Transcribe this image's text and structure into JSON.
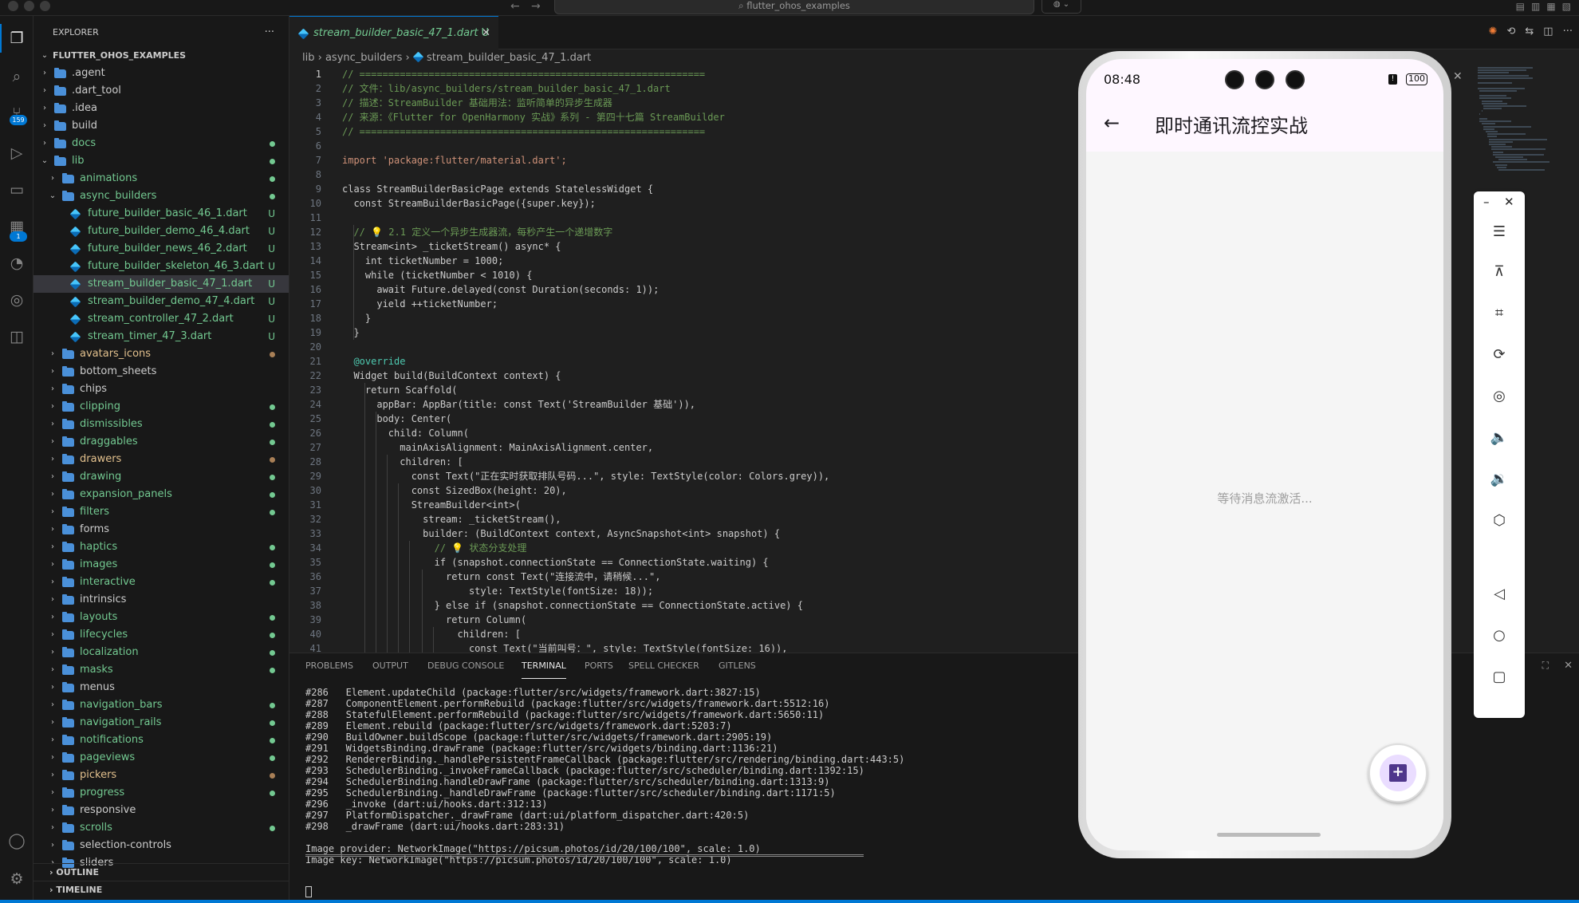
{
  "titlebar": {
    "search_text": "flutter_ohos_examples"
  },
  "activity_badges": {
    "scm": "159",
    "extensions": "1"
  },
  "explorer": {
    "title": "EXPLORER",
    "root": "FLUTTER_OHOS_EXAMPLES",
    "items": [
      {
        "label": ".agent",
        "kind": "folder",
        "depth": 1,
        "open": false,
        "color": "#cccccc",
        "mark": ""
      },
      {
        "label": ".dart_tool",
        "kind": "folder",
        "depth": 1,
        "open": false,
        "color": "#cccccc",
        "mark": ""
      },
      {
        "label": ".idea",
        "kind": "folder",
        "depth": 1,
        "open": false,
        "color": "#cccccc",
        "mark": ""
      },
      {
        "label": "build",
        "kind": "folder",
        "depth": 1,
        "open": false,
        "color": "#cccccc",
        "mark": ""
      },
      {
        "label": "docs",
        "kind": "folder",
        "depth": 1,
        "open": false,
        "color": "#73c991",
        "mark": "dot-green"
      },
      {
        "label": "lib",
        "kind": "folder",
        "depth": 1,
        "open": true,
        "color": "#73c991",
        "mark": "dot-green"
      },
      {
        "label": "animations",
        "kind": "folder",
        "depth": 2,
        "open": false,
        "color": "#73c991",
        "mark": "dot-green"
      },
      {
        "label": "async_builders",
        "kind": "folder",
        "depth": 2,
        "open": true,
        "color": "#73c991",
        "mark": "dot-green"
      },
      {
        "label": "future_builder_basic_46_1.dart",
        "kind": "dart",
        "depth": 3,
        "color": "#73c991",
        "mark": "U"
      },
      {
        "label": "future_builder_demo_46_4.dart",
        "kind": "dart",
        "depth": 3,
        "color": "#73c991",
        "mark": "U"
      },
      {
        "label": "future_builder_news_46_2.dart",
        "kind": "dart",
        "depth": 3,
        "color": "#73c991",
        "mark": "U"
      },
      {
        "label": "future_builder_skeleton_46_3.dart",
        "kind": "dart",
        "depth": 3,
        "color": "#73c991",
        "mark": "U"
      },
      {
        "label": "stream_builder_basic_47_1.dart",
        "kind": "dart",
        "depth": 3,
        "color": "#73c991",
        "mark": "U",
        "selected": true
      },
      {
        "label": "stream_builder_demo_47_4.dart",
        "kind": "dart",
        "depth": 3,
        "color": "#73c991",
        "mark": "U"
      },
      {
        "label": "stream_controller_47_2.dart",
        "kind": "dart",
        "depth": 3,
        "color": "#73c991",
        "mark": "U"
      },
      {
        "label": "stream_timer_47_3.dart",
        "kind": "dart",
        "depth": 3,
        "color": "#73c991",
        "mark": "U"
      },
      {
        "label": "avatars_icons",
        "kind": "folder",
        "depth": 2,
        "open": false,
        "color": "#e2c08d",
        "mark": "dot-brown"
      },
      {
        "label": "bottom_sheets",
        "kind": "folder",
        "depth": 2,
        "open": false,
        "color": "#cccccc",
        "mark": ""
      },
      {
        "label": "chips",
        "kind": "folder",
        "depth": 2,
        "open": false,
        "color": "#cccccc",
        "mark": ""
      },
      {
        "label": "clipping",
        "kind": "folder",
        "depth": 2,
        "open": false,
        "color": "#73c991",
        "mark": "dot-green"
      },
      {
        "label": "dismissibles",
        "kind": "folder",
        "depth": 2,
        "open": false,
        "color": "#73c991",
        "mark": "dot-green"
      },
      {
        "label": "draggables",
        "kind": "folder",
        "depth": 2,
        "open": false,
        "color": "#73c991",
        "mark": "dot-green"
      },
      {
        "label": "drawers",
        "kind": "folder",
        "depth": 2,
        "open": false,
        "color": "#e2c08d",
        "mark": "dot-brown"
      },
      {
        "label": "drawing",
        "kind": "folder",
        "depth": 2,
        "open": false,
        "color": "#73c991",
        "mark": "dot-green"
      },
      {
        "label": "expansion_panels",
        "kind": "folder",
        "depth": 2,
        "open": false,
        "color": "#73c991",
        "mark": "dot-green"
      },
      {
        "label": "filters",
        "kind": "folder",
        "depth": 2,
        "open": false,
        "color": "#73c991",
        "mark": "dot-green"
      },
      {
        "label": "forms",
        "kind": "folder",
        "depth": 2,
        "open": false,
        "color": "#cccccc",
        "mark": ""
      },
      {
        "label": "haptics",
        "kind": "folder",
        "depth": 2,
        "open": false,
        "color": "#73c991",
        "mark": "dot-green"
      },
      {
        "label": "images",
        "kind": "folder",
        "depth": 2,
        "open": false,
        "color": "#73c991",
        "mark": "dot-green"
      },
      {
        "label": "interactive",
        "kind": "folder",
        "depth": 2,
        "open": false,
        "color": "#73c991",
        "mark": "dot-green"
      },
      {
        "label": "intrinsics",
        "kind": "folder",
        "depth": 2,
        "open": false,
        "color": "#cccccc",
        "mark": ""
      },
      {
        "label": "layouts",
        "kind": "folder",
        "depth": 2,
        "open": false,
        "color": "#73c991",
        "mark": "dot-green"
      },
      {
        "label": "lifecycles",
        "kind": "folder",
        "depth": 2,
        "open": false,
        "color": "#73c991",
        "mark": "dot-green"
      },
      {
        "label": "localization",
        "kind": "folder",
        "depth": 2,
        "open": false,
        "color": "#73c991",
        "mark": "dot-green"
      },
      {
        "label": "masks",
        "kind": "folder",
        "depth": 2,
        "open": false,
        "color": "#73c991",
        "mark": "dot-green"
      },
      {
        "label": "menus",
        "kind": "folder",
        "depth": 2,
        "open": false,
        "color": "#cccccc",
        "mark": ""
      },
      {
        "label": "navigation_bars",
        "kind": "folder",
        "depth": 2,
        "open": false,
        "color": "#73c991",
        "mark": "dot-green"
      },
      {
        "label": "navigation_rails",
        "kind": "folder",
        "depth": 2,
        "open": false,
        "color": "#73c991",
        "mark": "dot-green"
      },
      {
        "label": "notifications",
        "kind": "folder",
        "depth": 2,
        "open": false,
        "color": "#73c991",
        "mark": "dot-green"
      },
      {
        "label": "pageviews",
        "kind": "folder",
        "depth": 2,
        "open": false,
        "color": "#73c991",
        "mark": "dot-green"
      },
      {
        "label": "pickers",
        "kind": "folder",
        "depth": 2,
        "open": false,
        "color": "#e2c08d",
        "mark": "dot-brown"
      },
      {
        "label": "progress",
        "kind": "folder",
        "depth": 2,
        "open": false,
        "color": "#73c991",
        "mark": "dot-green"
      },
      {
        "label": "responsive",
        "kind": "folder",
        "depth": 2,
        "open": false,
        "color": "#cccccc",
        "mark": ""
      },
      {
        "label": "scrolls",
        "kind": "folder",
        "depth": 2,
        "open": false,
        "color": "#73c991",
        "mark": "dot-green"
      },
      {
        "label": "selection-controls",
        "kind": "folder",
        "depth": 2,
        "open": false,
        "color": "#cccccc",
        "mark": ""
      },
      {
        "label": "sliders",
        "kind": "folder",
        "depth": 2,
        "open": false,
        "color": "#cccccc",
        "mark": ""
      }
    ],
    "outline": "OUTLINE",
    "timeline": "TIMELINE"
  },
  "editor": {
    "tab": {
      "label": "stream_builder_basic_47_1.dart",
      "badge": "U"
    },
    "breadcrumb": [
      "lib",
      "async_builders",
      "stream_builder_basic_47_1.dart"
    ],
    "lines": [
      "// ============================================================",
      "// 文件：lib/async_builders/stream_builder_basic_47_1.dart",
      "// 描述：StreamBuilder 基础用法：监听简单的异步生成器",
      "// 来源：《Flutter for OpenHarmony 实战》系列 - 第四十七篇 StreamBuilder",
      "// ============================================================",
      "",
      "import 'package:flutter/material.dart';",
      "",
      "class StreamBuilderBasicPage extends StatelessWidget {",
      "  const StreamBuilderBasicPage({super.key});",
      "",
      "  // 💡 2.1 定义一个异步生成器流，每秒产生一个递增数字",
      "  Stream<int> _ticketStream() async* {",
      "    int ticketNumber = 1000;",
      "    while (ticketNumber < 1010) {",
      "      await Future.delayed(const Duration(seconds: 1));",
      "      yield ++ticketNumber;",
      "    }",
      "  }",
      "",
      "  @override",
      "  Widget build(BuildContext context) {",
      "    return Scaffold(",
      "      appBar: AppBar(title: const Text('StreamBuilder 基础')),",
      "      body: Center(",
      "        child: Column(",
      "          mainAxisAlignment: MainAxisAlignment.center,",
      "          children: [",
      "            const Text(\"正在实时获取排队号码...\", style: TextStyle(color: Colors.grey)),",
      "            const SizedBox(height: 20),",
      "            StreamBuilder<int>(",
      "              stream: _ticketStream(),",
      "              builder: (BuildContext context, AsyncSnapshot<int> snapshot) {",
      "                // 💡 状态分支处理",
      "                if (snapshot.connectionState == ConnectionState.waiting) {",
      "                  return const Text(\"连接流中，请稍候...\",",
      "                      style: TextStyle(fontSize: 18));",
      "                } else if (snapshot.connectionState == ConnectionState.active) {",
      "                  return Column(",
      "                    children: [",
      "                      const Text(\"当前叫号：\", style: TextStyle(fontSize: 16)),"
    ]
  },
  "panel": {
    "tabs": [
      "PROBLEMS",
      "OUTPUT",
      "DEBUG CONSOLE",
      "TERMINAL",
      "PORTS",
      "SPELL CHECKER",
      "GITLENS"
    ],
    "active_tab": "TERMINAL",
    "terminal_lines": [
      "#286   Element.updateChild (package:flutter/src/widgets/framework.dart:3827:15)",
      "#287   ComponentElement.performRebuild (package:flutter/src/widgets/framework.dart:5512:16)",
      "#288   StatefulElement.performRebuild (package:flutter/src/widgets/framework.dart:5650:11)",
      "#289   Element.rebuild (package:flutter/src/widgets/framework.dart:5203:7)",
      "#290   BuildOwner.buildScope (package:flutter/src/widgets/framework.dart:2905:19)",
      "#291   WidgetsBinding.drawFrame (package:flutter/src/widgets/binding.dart:1136:21)",
      "#292   RendererBinding._handlePersistentFrameCallback (package:flutter/src/rendering/binding.dart:443:5)",
      "#293   SchedulerBinding._invokeFrameCallback (package:flutter/src/scheduler/binding.dart:1392:15)",
      "#294   SchedulerBinding.handleDrawFrame (package:flutter/src/scheduler/binding.dart:1313:9)",
      "#295   SchedulerBinding._handleDrawFrame (package:flutter/src/scheduler/binding.dart:1171:5)",
      "#296   _invoke (dart:ui/hooks.dart:312:13)",
      "#297   PlatformDispatcher._drawFrame (dart:ui/platform_dispatcher.dart:420:5)",
      "#298   _drawFrame (dart:ui/hooks.dart:283:31)",
      "",
      "Image provider: NetworkImage(\"https://picsum.photos/id/20/100/100\", scale: 1.0)",
      "Image key: NetworkImage(\"https://picsum.photos/id/20/100/100\", scale: 1.0)"
    ]
  },
  "phone": {
    "time": "08:48",
    "battery": "100",
    "warning_glyph": "!",
    "app_title": "即时通讯流控实战",
    "waiting_text": "等待消息流激活..."
  },
  "colors": {
    "accent": "#0078d4",
    "untracked": "#73c991",
    "modified": "#e2c08d",
    "fab_bg": "#eaddff",
    "fab_icon": "#4f378b"
  }
}
